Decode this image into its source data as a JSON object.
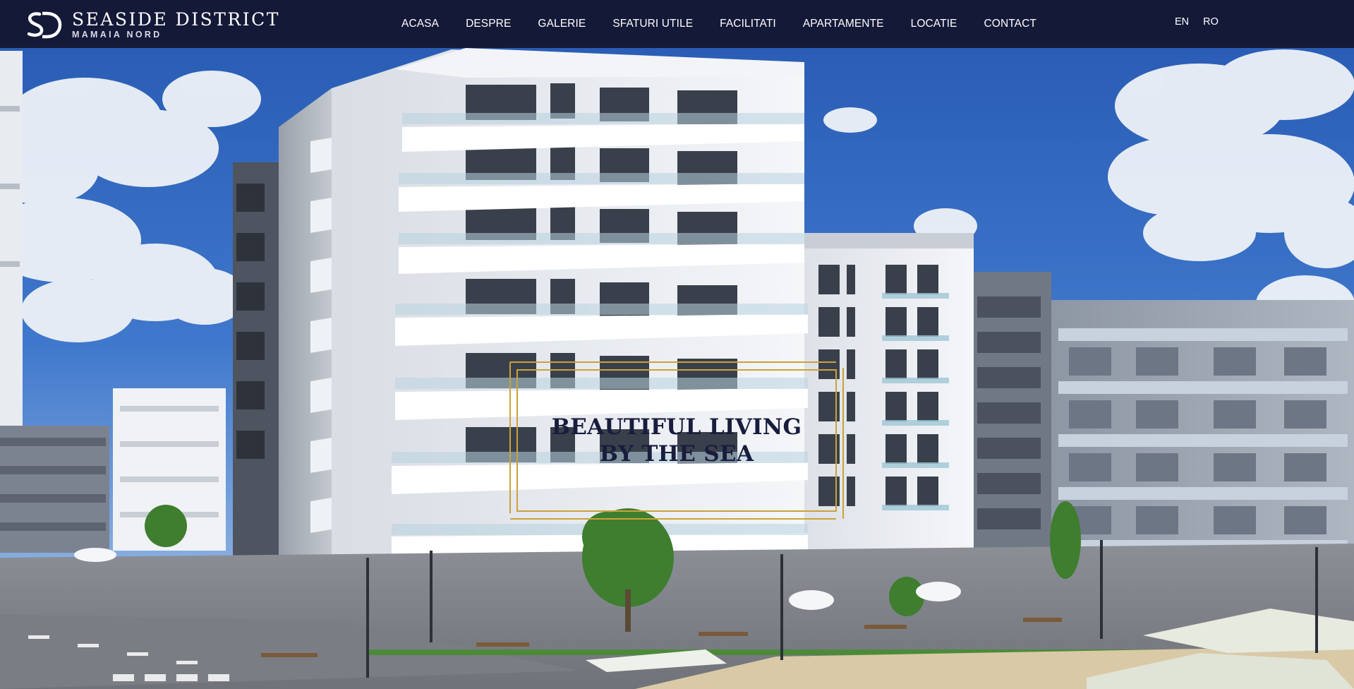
{
  "brand": {
    "name": "SEASIDE DISTRICT",
    "subtitle": "MAMAIA NORD",
    "logo_icon": "sd-monogram-icon"
  },
  "nav": {
    "items": [
      "ACASA",
      "DESPRE",
      "GALERIE",
      "SFATURI UTILE",
      "FACILITATI",
      "APARTAMENTE",
      "LOCATIE",
      "CONTACT"
    ]
  },
  "languages": [
    "EN",
    "RO"
  ],
  "hero": {
    "tagline_line1": "BEAUTIFUL LIVING",
    "tagline_line2": "BY THE SEA",
    "image": "residential-building-render"
  },
  "colors": {
    "header_bg": "#151938",
    "frame_gold": "#c9a33a",
    "tagline_text": "#191d3d",
    "sky": "#2f63b8"
  }
}
